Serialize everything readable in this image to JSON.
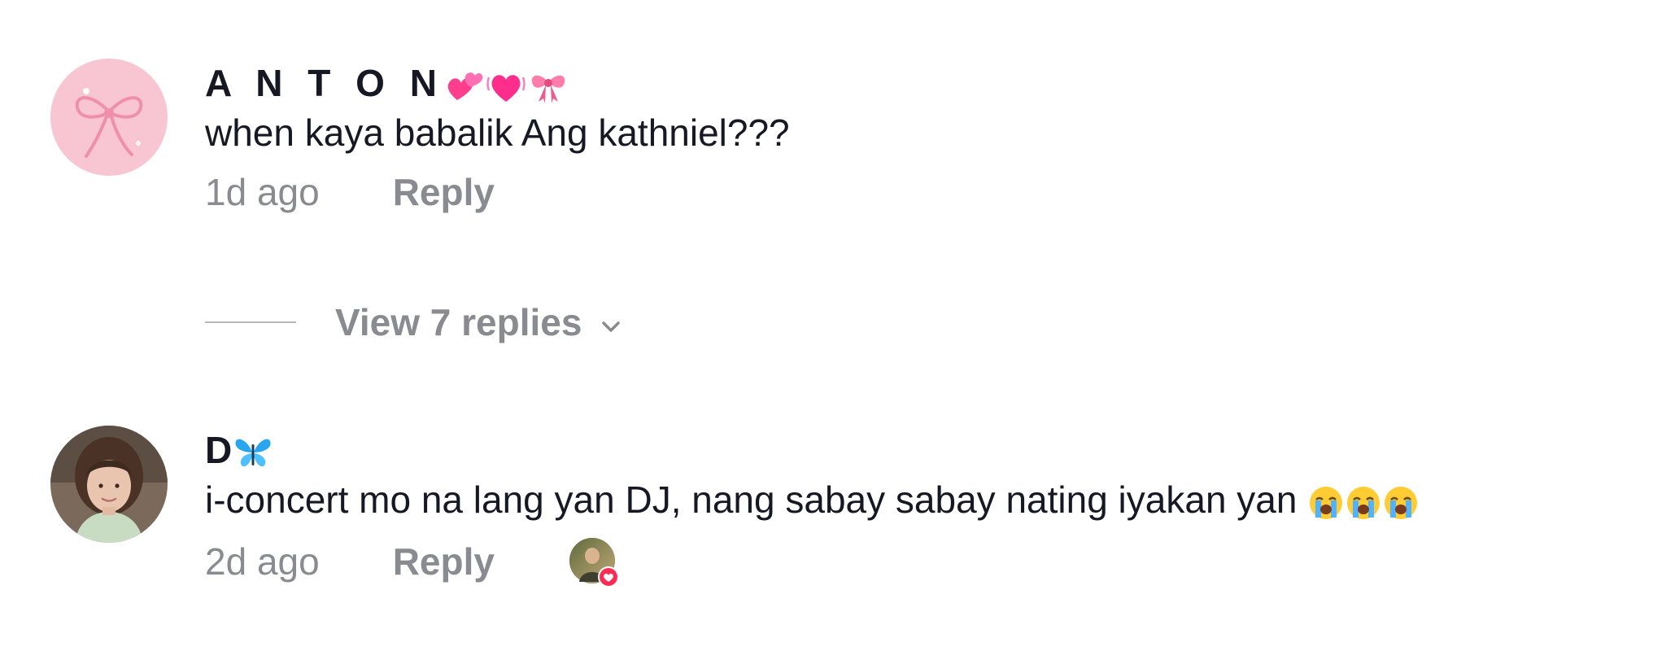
{
  "comments": [
    {
      "username": "A N T O N",
      "username_emojis": [
        "two-hearts",
        "heartbeat",
        "ribbon"
      ],
      "text": "when kaya babalik Ang kathniel???",
      "time": "1d ago",
      "reply_label": "Reply",
      "view_replies_label": "View 7 replies"
    },
    {
      "username": "D",
      "username_emojis": [
        "blue-butterfly"
      ],
      "text": "i-concert mo na lang yan DJ, nang sabay sabay nating iyakan yan",
      "text_emojis": [
        "loudly-crying-face",
        "loudly-crying-face",
        "loudly-crying-face"
      ],
      "time": "2d ago",
      "reply_label": "Reply",
      "liked_by_creator": true
    }
  ],
  "colors": {
    "text": "#161823",
    "muted": "#8a8b91",
    "liked_badge": "#fe2c55"
  }
}
